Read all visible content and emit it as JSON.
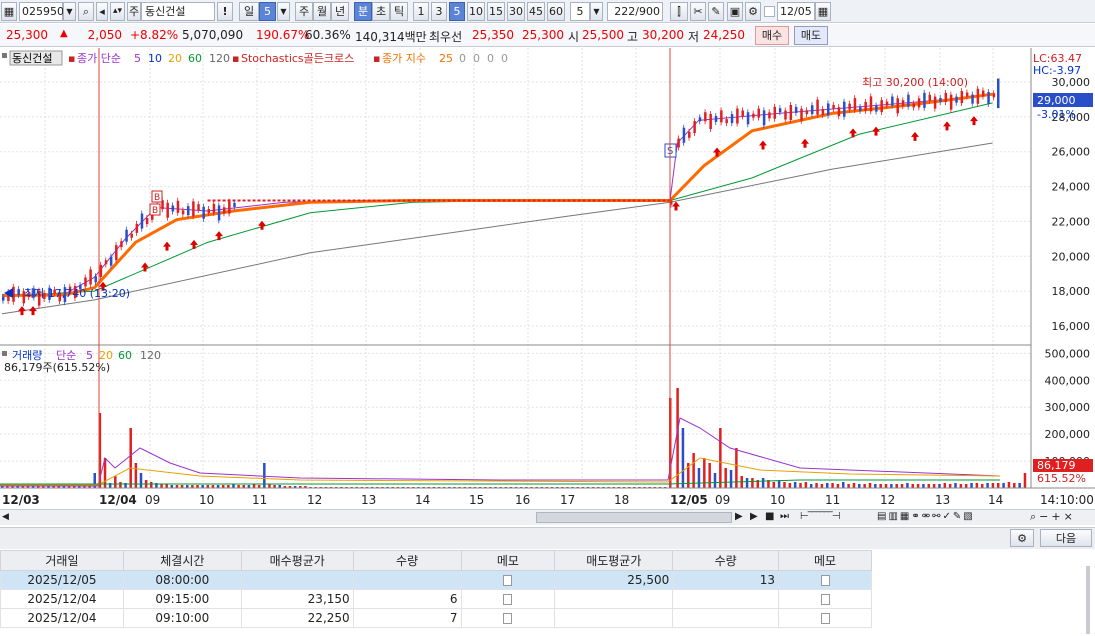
{
  "toolbar": {
    "code": "025950",
    "name_prefix": "주",
    "stock_name": "동신건설",
    "warn": "!",
    "period_day": "일",
    "period_num": "5",
    "p_week": "주",
    "p_month": "월",
    "p_year": "년",
    "p_min": "분",
    "p_sec": "초",
    "p_tick": "틱",
    "intervals": [
      "1",
      "3",
      "5",
      "10",
      "15",
      "30",
      "45",
      "60"
    ],
    "interval_num": "5",
    "count": "222",
    "count_total": "/900",
    "date": "12/05"
  },
  "quote": {
    "price": "25,300",
    "change": "2,050",
    "change_pct": "+8.82%",
    "volume": "5,070,090",
    "vol_ratio": "190.67%",
    "turnover": "60.36%",
    "amount": "140,314백만",
    "best_label": "최우선",
    "ask": "25,350",
    "bid": "25,300",
    "open_label": "시",
    "open": "25,500",
    "high_label": "고",
    "high": "30,200",
    "low_label": "저",
    "low": "24,250",
    "buy_btn": "매수",
    "sell_btn": "매도"
  },
  "legend": {
    "name": "동신건설",
    "ma_label": "종가 단순",
    "ma": [
      "5",
      "10",
      "20",
      "60",
      "120"
    ],
    "stoch": "Stochastics골든크로스",
    "ema_label": "종가 지수",
    "ema": [
      "25",
      "0",
      "0",
      "0",
      "0"
    ],
    "vol_label": "거래량",
    "vol_ma_label": "단순",
    "vol_ma": [
      "5",
      "20",
      "60",
      "120"
    ],
    "vol_value": "86,179주(615.52%)"
  },
  "annotations": {
    "max_label": "최고 30,200 (14:00)",
    "min_label": "최저 17,740 (13:20)",
    "lc": "LC:63.47",
    "hc": "HC:-3.97",
    "current_price": "29,000",
    "current_pct": "-3.01%",
    "current_vol": "86,179",
    "current_vol_pct": "615.52%"
  },
  "chart_data": {
    "type": "candlestick",
    "price_ticks": [
      "30,000",
      "28,000",
      "26,000",
      "24,000",
      "22,000",
      "20,000",
      "18,000",
      "16,000"
    ],
    "vol_ticks": [
      "500,000",
      "400,000",
      "300,000",
      "200,000",
      "100,000"
    ],
    "x_labels": [
      "12/03",
      "12/04",
      "09",
      "10",
      "11",
      "12",
      "13",
      "14",
      "15",
      "16",
      "17",
      "18",
      "12/05",
      "09",
      "10",
      "11",
      "12",
      "13",
      "14",
      "14:10:00"
    ],
    "ma5": [
      [
        0,
        17750
      ],
      [
        12,
        17800
      ],
      [
        18,
        18800
      ],
      [
        24,
        21000
      ],
      [
        30,
        22800
      ],
      [
        40,
        22600
      ],
      [
        55,
        23100
      ],
      [
        70,
        23200
      ],
      [
        100,
        23200
      ],
      [
        130,
        23200
      ],
      [
        131,
        26500
      ],
      [
        135,
        27800
      ],
      [
        150,
        28200
      ],
      [
        170,
        28700
      ],
      [
        185,
        29100
      ],
      [
        190,
        29300
      ]
    ],
    "ema25": [
      [
        0,
        17750
      ],
      [
        12,
        17780
      ],
      [
        18,
        18200
      ],
      [
        26,
        20800
      ],
      [
        34,
        22100
      ],
      [
        45,
        22600
      ],
      [
        60,
        23100
      ],
      [
        80,
        23200
      ],
      [
        130,
        23200
      ],
      [
        136,
        25200
      ],
      [
        145,
        27200
      ],
      [
        160,
        28200
      ],
      [
        175,
        28700
      ],
      [
        190,
        29300
      ]
    ],
    "ma60": [
      [
        0,
        17700
      ],
      [
        18,
        18000
      ],
      [
        40,
        20800
      ],
      [
        60,
        22500
      ],
      [
        80,
        23100
      ],
      [
        100,
        23200
      ],
      [
        130,
        23200
      ],
      [
        145,
        24500
      ],
      [
        165,
        27000
      ],
      [
        190,
        28800
      ]
    ],
    "ma120": [
      [
        0,
        16700
      ],
      [
        18,
        17500
      ],
      [
        60,
        20200
      ],
      [
        110,
        22300
      ],
      [
        130,
        23100
      ],
      [
        160,
        25000
      ],
      [
        190,
        26500
      ]
    ],
    "volumes": [
      0.02,
      0.02,
      0.03,
      0.02,
      0.03,
      0.02,
      0.02,
      0.03,
      0.02,
      0.02,
      0.02,
      0.03,
      0.02,
      0.02,
      0.02,
      0.02,
      0.02,
      0.02,
      0.15,
      0.75,
      0.3,
      0.05,
      0.12,
      0.06,
      0.05,
      0.6,
      0.25,
      0.15,
      0.08,
      0.06,
      0.05,
      0.04,
      0.04,
      0.03,
      0.03,
      0.03,
      0.03,
      0.03,
      0.03,
      0.03,
      0.03,
      0.03,
      0.03,
      0.03,
      0.03,
      0.04,
      0.03,
      0.03,
      0.03,
      0.04,
      0.03,
      0.25,
      0.04,
      0.03,
      0.03,
      0.02,
      0.02,
      0.02,
      0.02,
      0.02,
      0.01,
      0.01,
      0.01,
      0.01,
      0.01,
      0.01,
      0.01,
      0.01,
      0.01,
      0.01,
      0.01,
      0.01,
      0.01,
      0.01,
      0.01,
      0.01,
      0.01,
      0.01,
      0.01,
      0.01,
      0.01,
      0.01,
      0.01,
      0.01,
      0.01,
      0.01,
      0.01,
      0.01,
      0.01,
      0.01,
      0.01,
      0.01,
      0.01,
      0.01,
      0.01,
      0.01,
      0.01,
      0.01,
      0.01,
      0.01,
      0.01,
      0.01,
      0.01,
      0.01,
      0.01,
      0.01,
      0.01,
      0.01,
      0.01,
      0.01,
      0.01,
      0.01,
      0.01,
      0.01,
      0.01,
      0.01,
      0.01,
      0.01,
      0.01,
      0.01,
      0.01,
      0.01,
      0.01,
      0.01,
      0.01,
      0.01,
      0.01,
      0.01,
      0.01,
      0.01,
      0.9,
      1.0,
      0.6,
      0.25,
      0.35,
      0.2,
      0.3,
      0.25,
      0.15,
      0.6,
      0.2,
      0.18,
      0.4,
      0.12,
      0.1,
      0.1,
      0.08,
      0.1,
      0.08,
      0.06,
      0.08,
      0.06,
      0.05,
      0.06,
      0.05,
      0.06,
      0.04,
      0.05,
      0.04,
      0.05,
      0.05,
      0.04,
      0.06,
      0.04,
      0.05,
      0.04,
      0.04,
      0.05,
      0.04,
      0.04,
      0.04,
      0.04,
      0.04,
      0.04,
      0.05,
      0.04,
      0.04,
      0.04,
      0.04,
      0.04,
      0.04,
      0.05,
      0.04,
      0.05,
      0.04,
      0.04,
      0.05,
      0.05,
      0.04,
      0.05,
      0.05,
      0.05,
      0.05,
      0.06,
      0.05,
      0.05,
      0.15
    ]
  },
  "grid": {
    "headers": [
      "거래일",
      "체결시간",
      "매수평균가",
      "수량",
      "메모",
      "매도평균가",
      "수량",
      "메모"
    ],
    "rows": [
      [
        "2025/12/05",
        "08:00:00",
        "",
        "",
        "",
        "25,500",
        "13",
        ""
      ],
      [
        "2025/12/04",
        "09:15:00",
        "23,150",
        "6",
        "",
        "",
        "",
        ""
      ],
      [
        "2025/12/04",
        "09:10:00",
        "22,250",
        "7",
        "",
        "",
        "",
        ""
      ]
    ],
    "next_btn": "다음"
  }
}
